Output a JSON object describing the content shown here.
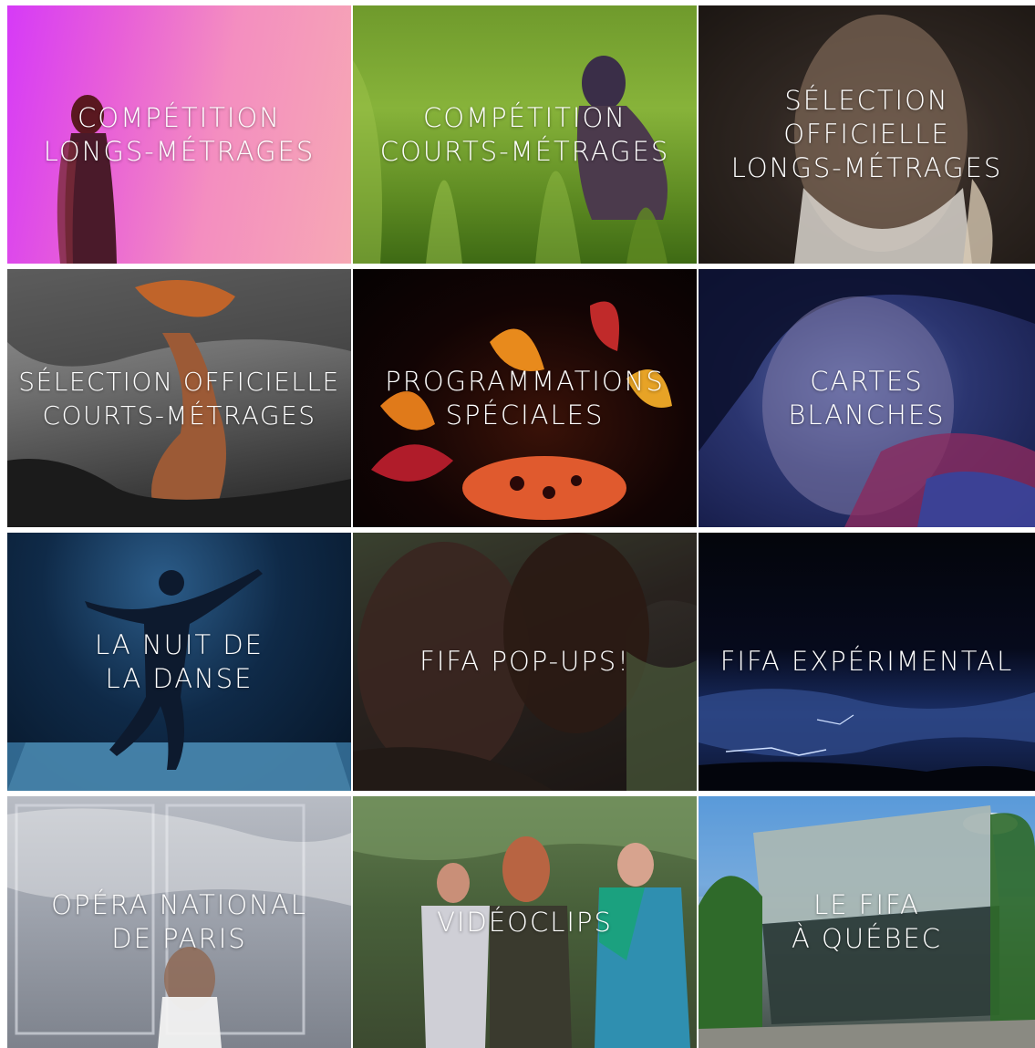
{
  "tiles": [
    {
      "label": "COMPÉTITION\nLONGS-MÉTRAGES",
      "color": "#e85fd8"
    },
    {
      "label": "COMPÉTITION\nCOURTS-MÉTRAGES",
      "color": "#87b33a"
    },
    {
      "label": "SÉLECTION OFFICIELLE\nLONGS-MÉTRAGES",
      "color": "#3b312b"
    },
    {
      "label": "SÉLECTION OFFICIELLE\nCOURTS-MÉTRAGES",
      "color": "#6f6f6f"
    },
    {
      "label": "PROGRAMMATIONS\nSPÉCIALES",
      "color": "#120404"
    },
    {
      "label": "CARTES\nBLANCHES",
      "color": "#2b3570"
    },
    {
      "label": "LA NUIT DE\nLA DANSE",
      "color": "#0f2a48"
    },
    {
      "label": "FIFA POP-UPS!",
      "color": "#2f2a26"
    },
    {
      "label": "FIFA EXPÉRIMENTAL",
      "color": "#060a1c"
    },
    {
      "label": "OPÉRA NATIONAL\nDE PARIS",
      "color": "#9ea3ad"
    },
    {
      "label": "VIDÉOCLIPS",
      "color": "#48603a"
    },
    {
      "label": "LE FIFA\nÀ QUÉBEC",
      "color": "#8ab8e2"
    }
  ]
}
